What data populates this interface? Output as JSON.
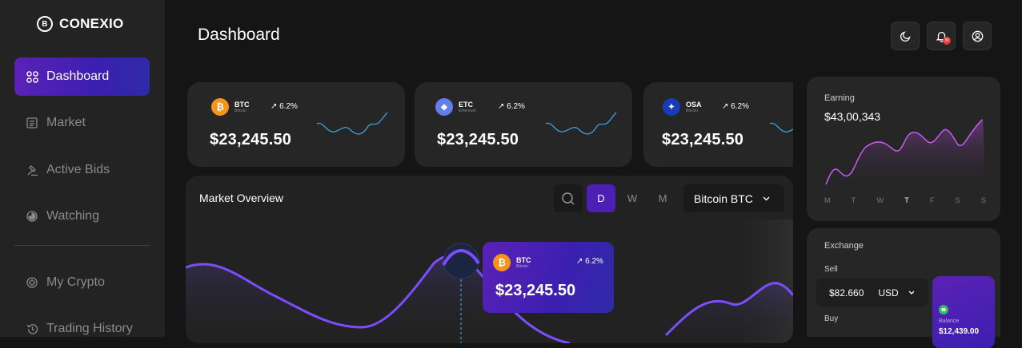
{
  "brand": {
    "name": "CONEXIO",
    "logo_icon": "bitcoin-circle-icon"
  },
  "sidebar": {
    "items": [
      {
        "label": "Dashboard",
        "icon": "grid-icon",
        "active": true
      },
      {
        "label": "Market",
        "icon": "market-icon",
        "active": false
      },
      {
        "label": "Active Bids",
        "icon": "gavel-icon",
        "active": false
      },
      {
        "label": "Watching",
        "icon": "eye-icon",
        "active": false
      },
      {
        "label": "My Crypto",
        "icon": "crypto-icon",
        "active": false
      },
      {
        "label": "Trading History",
        "icon": "history-icon",
        "active": false
      }
    ]
  },
  "header": {
    "title": "Dashboard",
    "notification_count": "30"
  },
  "coins": [
    {
      "symbol": "BTC",
      "name": "Bitcoin",
      "change": "↗ 6.2%",
      "price": "$23,245.50",
      "color": "#f7931a",
      "glyph": "₿"
    },
    {
      "symbol": "ETC",
      "name": "Ethereum",
      "change": "↗ 6.2%",
      "price": "$23,245.50",
      "color": "#627eea",
      "glyph": "◆"
    },
    {
      "symbol": "OSA",
      "name": "Bitcoin",
      "change": "↗ 6.2%",
      "price": "$23,245.50",
      "color": "#1a3bb8",
      "glyph": "✦"
    }
  ],
  "market": {
    "title": "Market Overview",
    "ranges": [
      "D",
      "W",
      "M"
    ],
    "active_range": "D",
    "selected_coin": "Bitcoin BTC",
    "tooltip": {
      "symbol": "BTC",
      "name": "Bitcoin",
      "change": "↗ 6.2%",
      "price": "$23,245.50"
    }
  },
  "earning": {
    "label": "Earning",
    "amount": "$43,00,343",
    "days": [
      "M",
      "T",
      "W",
      "T",
      "F",
      "S",
      "S"
    ],
    "active_day_index": 3
  },
  "exchange": {
    "label": "Exchange",
    "sell_label": "Sell",
    "sell_value": "$82.660",
    "currency": "USD",
    "buy_label": "Buy",
    "balance_label": "Balance",
    "balance_value": "$12,439.00"
  },
  "colors": {
    "accent": "#4c1fb5",
    "sparkline": "#3aa0d8",
    "chart_line": "#7c4dff"
  }
}
